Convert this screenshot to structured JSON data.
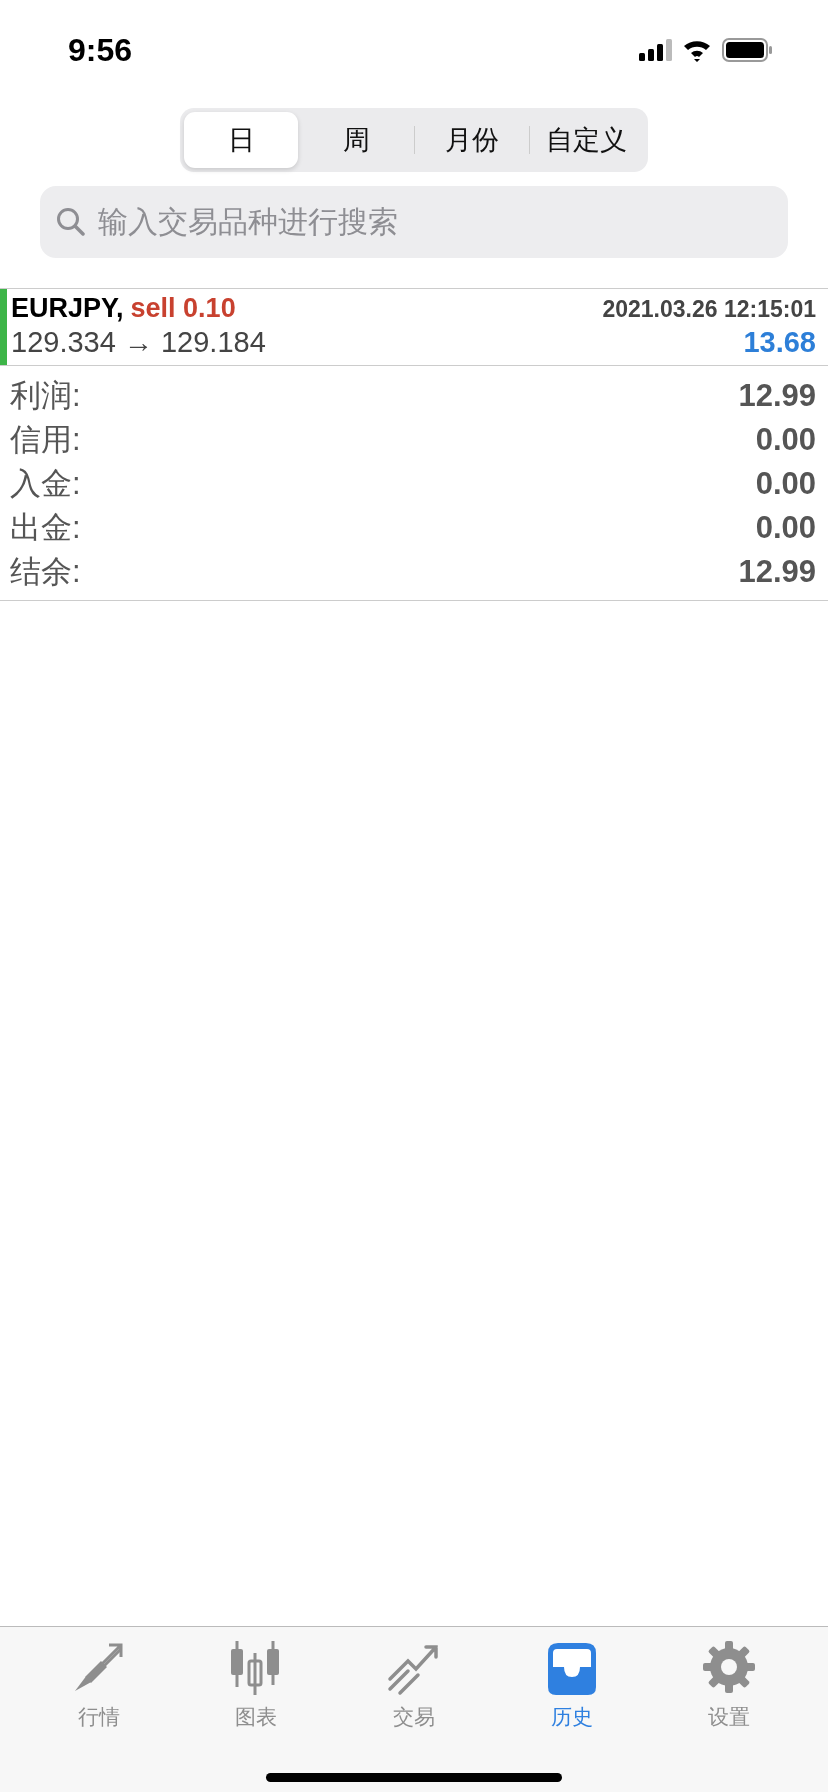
{
  "status_bar": {
    "time": "9:56"
  },
  "segments": [
    {
      "label": "日",
      "selected": true
    },
    {
      "label": "周",
      "selected": false
    },
    {
      "label": "月份",
      "selected": false
    },
    {
      "label": "自定义",
      "selected": false
    }
  ],
  "search": {
    "placeholder": "输入交易品种进行搜索"
  },
  "trades": [
    {
      "symbol": "EURJPY,",
      "order": "sell 0.10",
      "time": "2021.03.26 12:15:01",
      "prices": "129.334 → 129.184",
      "profit": "13.68"
    }
  ],
  "summary": [
    {
      "label": "利润:",
      "value": "12.99"
    },
    {
      "label": "信用:",
      "value": "0.00"
    },
    {
      "label": "入金:",
      "value": "0.00"
    },
    {
      "label": "出金:",
      "value": "0.00"
    },
    {
      "label": "结余:",
      "value": "12.99"
    }
  ],
  "tab_bar": [
    {
      "kind": "quotes",
      "label": "行情",
      "selected": false
    },
    {
      "kind": "chart",
      "label": "图表",
      "selected": false
    },
    {
      "kind": "trade",
      "label": "交易",
      "selected": false
    },
    {
      "kind": "history",
      "label": "历史",
      "selected": true
    },
    {
      "kind": "settings",
      "label": "设置",
      "selected": false
    }
  ]
}
